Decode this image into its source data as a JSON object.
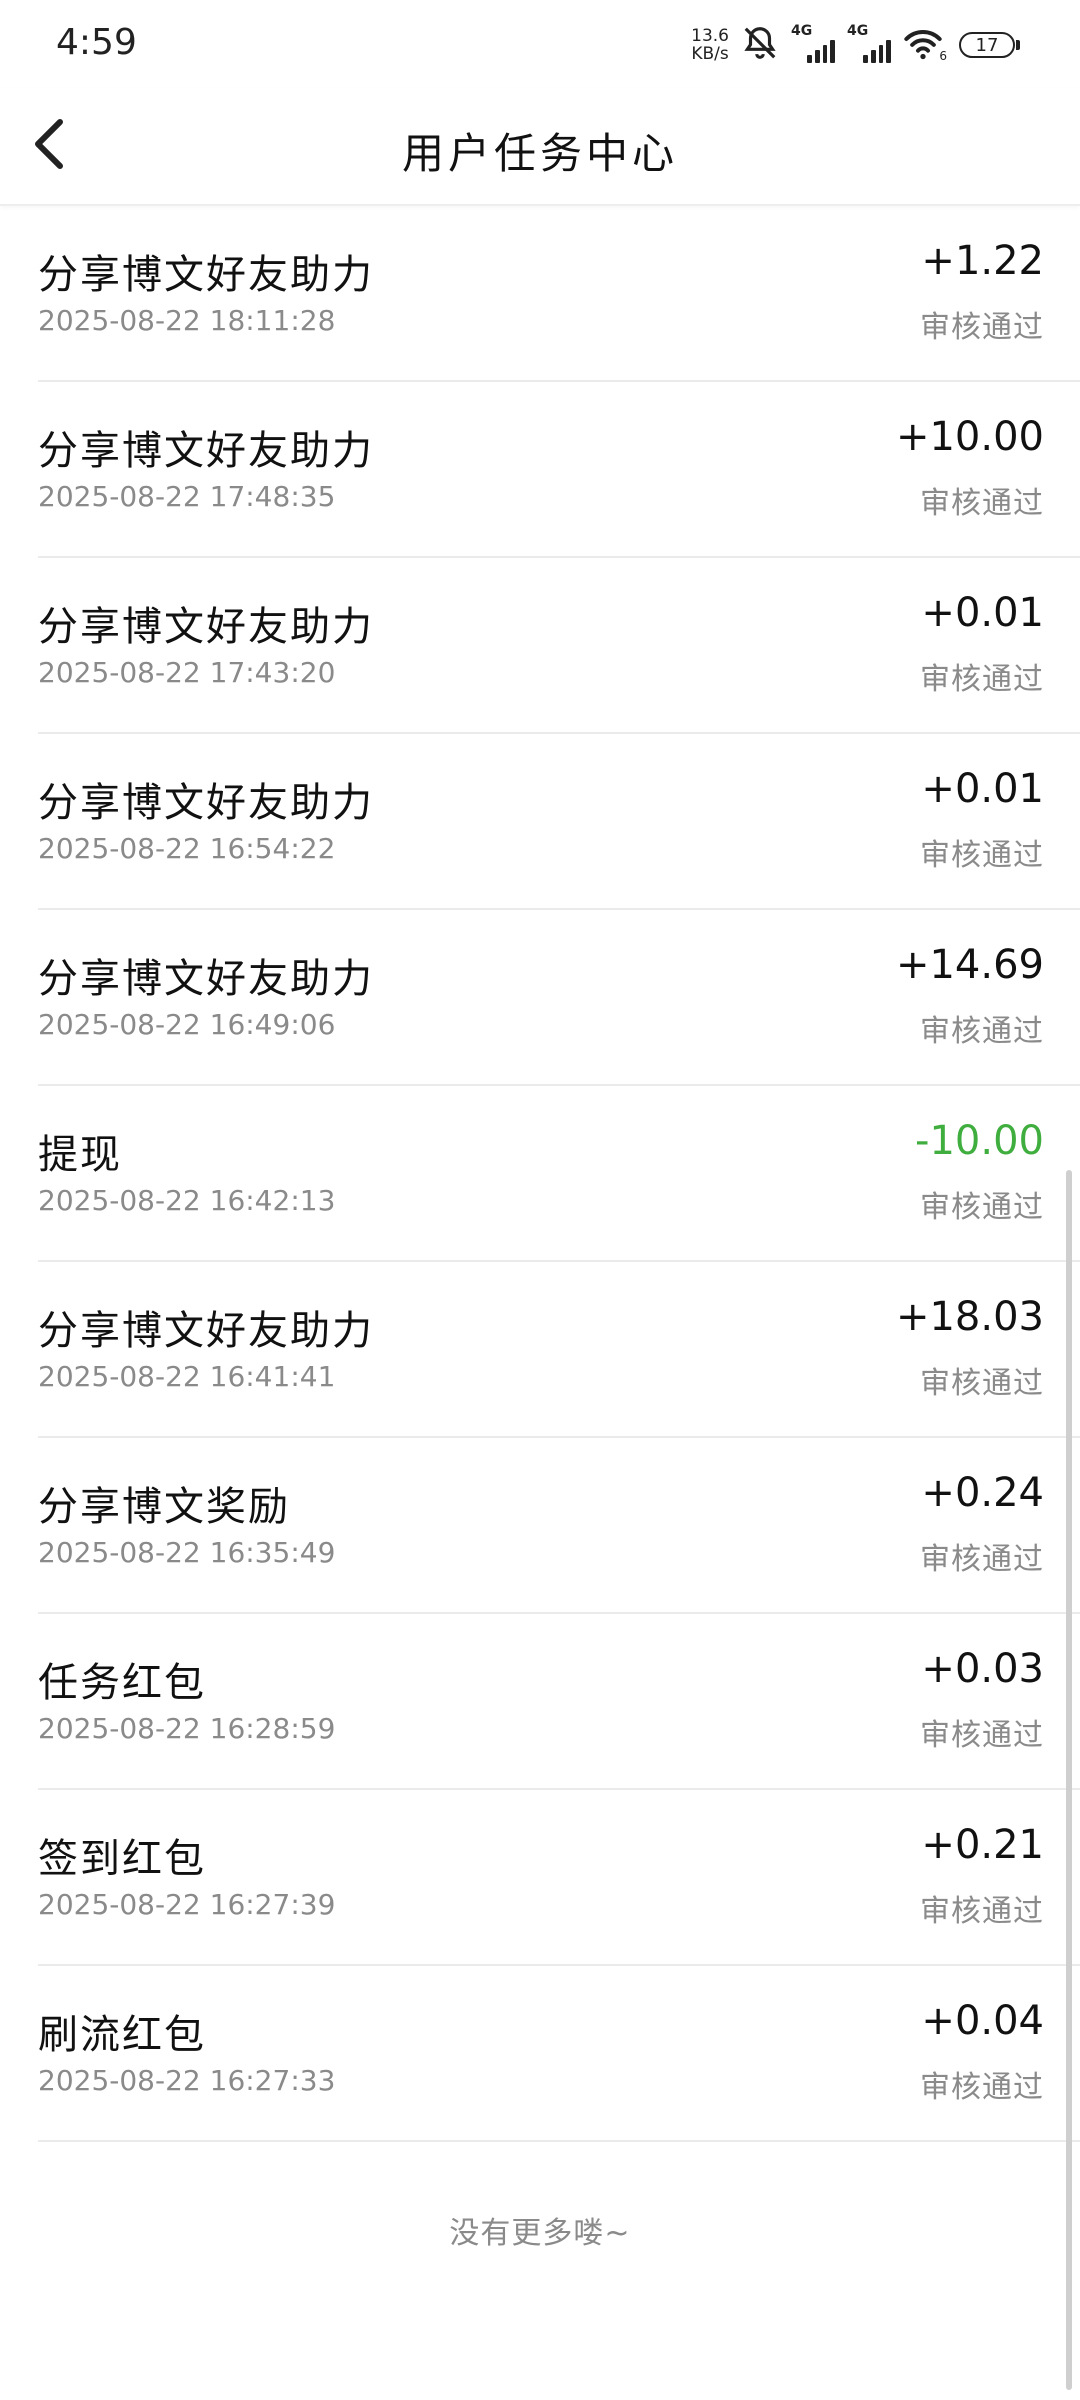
{
  "status_bar": {
    "time": "4:59",
    "net_speed_value": "13.6",
    "net_speed_unit": "KB/s",
    "sim1_label": "4G",
    "sim2_label": "4G",
    "wifi_label": "6",
    "battery": "17",
    "icons": [
      "bell-muted-icon",
      "signal-icon",
      "signal-icon",
      "wifi-icon",
      "battery-icon"
    ]
  },
  "nav": {
    "back_icon": "chevron-left-icon",
    "title": "用户任务中心"
  },
  "records": [
    {
      "title": "分享博文好友助力",
      "time": "2025-08-22 18:11:28",
      "amount": "+1.22",
      "status": "审核通过"
    },
    {
      "title": "分享博文好友助力",
      "time": "2025-08-22 17:48:35",
      "amount": "+10.00",
      "status": "审核通过"
    },
    {
      "title": "分享博文好友助力",
      "time": "2025-08-22 17:43:20",
      "amount": "+0.01",
      "status": "审核通过"
    },
    {
      "title": "分享博文好友助力",
      "time": "2025-08-22 16:54:22",
      "amount": "+0.01",
      "status": "审核通过"
    },
    {
      "title": "分享博文好友助力",
      "time": "2025-08-22 16:49:06",
      "amount": "+14.69",
      "status": "审核通过"
    },
    {
      "title": "提现",
      "time": "2025-08-22 16:42:13",
      "amount": "-10.00",
      "status": "审核通过"
    },
    {
      "title": "分享博文好友助力",
      "time": "2025-08-22 16:41:41",
      "amount": "+18.03",
      "status": "审核通过"
    },
    {
      "title": "分享博文奖励",
      "time": "2025-08-22 16:35:49",
      "amount": "+0.24",
      "status": "审核通过"
    },
    {
      "title": "任务红包",
      "time": "2025-08-22 16:28:59",
      "amount": "+0.03",
      "status": "审核通过"
    },
    {
      "title": "签到红包",
      "time": "2025-08-22 16:27:39",
      "amount": "+0.21",
      "status": "审核通过"
    },
    {
      "title": "刷流红包",
      "time": "2025-08-22 16:27:33",
      "amount": "+0.04",
      "status": "审核通过"
    }
  ],
  "footer": {
    "no_more": "没有更多喽~"
  },
  "colors": {
    "positive_amount": "#111111",
    "negative_amount": "#3fae3f",
    "secondary_text": "#8a8a8a",
    "divider": "#ebebeb"
  }
}
